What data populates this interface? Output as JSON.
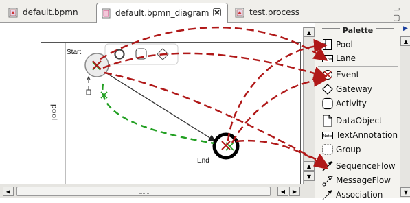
{
  "tabs": [
    {
      "label": "default.bpmn",
      "active": false
    },
    {
      "label": "default.bpmn_diagram",
      "active": true
    },
    {
      "label": "test.process",
      "active": false
    }
  ],
  "view_controls": "▭ ▢",
  "diagram": {
    "pool_label": "pool",
    "start_label": "Start",
    "end_label": "End"
  },
  "palette": {
    "title": "Palette",
    "items": [
      {
        "label": "Pool",
        "icon": "pool-icon"
      },
      {
        "label": "Lane",
        "icon": "lane-icon"
      },
      {
        "label": "Event",
        "icon": "event-icon"
      },
      {
        "label": "Gateway",
        "icon": "gateway-icon"
      },
      {
        "label": "Activity",
        "icon": "activity-icon"
      },
      {
        "label": "DataObject",
        "icon": "data-object-icon"
      },
      {
        "label": "TextAnnotation",
        "icon": "text-annotation-icon"
      },
      {
        "label": "Group",
        "icon": "group-icon"
      },
      {
        "label": "SequenceFlow",
        "icon": "sequence-flow-icon"
      },
      {
        "label": "MessageFlow",
        "icon": "message-flow-icon"
      },
      {
        "label": "Association",
        "icon": "association-icon"
      }
    ],
    "lane_icon_text": "Lane",
    "note_icon_text": "Note"
  },
  "colors": {
    "dashed_red": "#b01818",
    "dashed_green": "#23a023",
    "tab_active_bg": "#ffffff",
    "tab_bar_bg": "#f0efeb"
  }
}
